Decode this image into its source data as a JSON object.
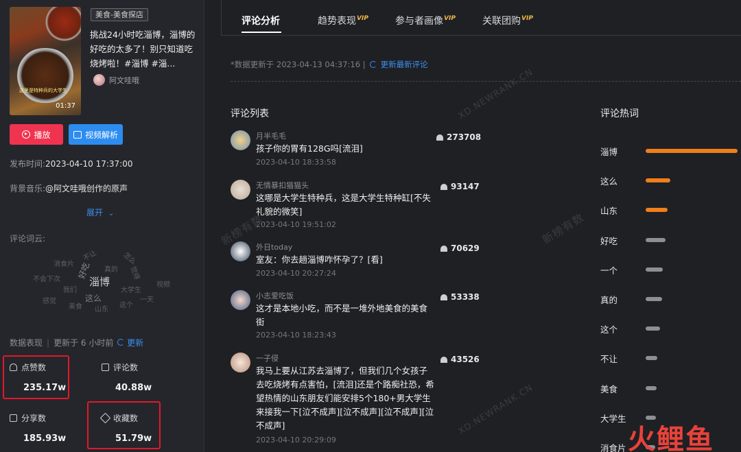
{
  "video": {
    "category": "美食-美食探店",
    "title": "挑战24小时吃淄博，淄博的好吃的太多了！别只知道吃烧烤啦！#淄博 #淄...",
    "author": "阿文哇哦",
    "duration": "01:37",
    "thumb_caption": "这里是特种兵的大学生"
  },
  "actions": {
    "play": "播放",
    "analyze": "视频解析"
  },
  "meta": {
    "publish_label": "发布时间:",
    "publish_time": "2023-04-10 17:37:00",
    "music_label": "背景音乐:",
    "music": "@阿文哇哦创作的原声",
    "expand": "展开"
  },
  "wordcloud": {
    "label": "评论词云:",
    "words": [
      "不让",
      "怎么",
      "消食片",
      "好吃",
      "真的",
      "不会下次",
      "淄博",
      "觉得",
      "大学生",
      "视频",
      "我们",
      "这么",
      "一天",
      "感觉",
      "美食",
      "这个",
      "山东"
    ]
  },
  "stats": {
    "header": "数据表现",
    "updated": "更新于 6 小时前",
    "refresh": "更新",
    "likes_label": "点赞数",
    "likes": "235.17w",
    "comments_label": "评论数",
    "comments": "40.88w",
    "shares_label": "分享数",
    "shares": "185.93w",
    "favorites_label": "收藏数",
    "favorites": "51.79w"
  },
  "tabs": [
    {
      "label": "评论分析",
      "vip": ""
    },
    {
      "label": "趋势表现",
      "vip": "VIP"
    },
    {
      "label": "参与者画像",
      "vip": "VIP"
    },
    {
      "label": "关联团购",
      "vip": "VIP"
    }
  ],
  "update": {
    "text": "*数据更新于 2023-04-13 04:37:16 |",
    "link": "更新最新评论"
  },
  "comment_list": {
    "title": "评论列表",
    "items": [
      {
        "user": "月半毛毛",
        "text": "孩子你的胃有128G吗[流泪]",
        "time": "2023-04-10 18:33:58",
        "likes": "273708"
      },
      {
        "user": "无情暴扣猫猫头",
        "text": "这哪是大学生特种兵，这是大学生特种缸[不失礼貌的微笑]",
        "time": "2023-04-10 19:51:02",
        "likes": "93147"
      },
      {
        "user": "外日today",
        "text": "室友：你去趟淄博咋怀孕了？[看]",
        "time": "2023-04-10 20:27:24",
        "likes": "70629"
      },
      {
        "user": "小志爱吃饭",
        "text": "这才是本地小吃，而不是一堆外地美食的美食街",
        "time": "2023-04-10 18:23:43",
        "likes": "53338"
      },
      {
        "user": "一子侵",
        "text": "我马上要从江苏去淄博了，但我们几个女孩子去吃烧烤有点害怕，[流泪]还是个路痴社恐，希望热情的山东朋友们能安排5个180+男大学生来接我一下[泣不成声][泣不成声][泣不成声][泣不成声]",
        "time": "2023-04-10 20:29:09",
        "likes": "43526"
      }
    ]
  },
  "hot_words": {
    "title": "评论热词",
    "items": [
      {
        "word": "淄博",
        "value": 1.0,
        "color": "#f07f1a"
      },
      {
        "word": "这么",
        "value": 0.27,
        "color": "#f07f1a"
      },
      {
        "word": "山东",
        "value": 0.24,
        "color": "#f07f1a"
      },
      {
        "word": "好吃",
        "value": 0.22,
        "color": "#8e8f93"
      },
      {
        "word": "一个",
        "value": 0.19,
        "color": "#8e8f93"
      },
      {
        "word": "真的",
        "value": 0.18,
        "color": "#8e8f93"
      },
      {
        "word": "这个",
        "value": 0.16,
        "color": "#8e8f93"
      },
      {
        "word": "不让",
        "value": 0.13,
        "color": "#8e8f93"
      },
      {
        "word": "美食",
        "value": 0.12,
        "color": "#8e8f93"
      },
      {
        "word": "大学生",
        "value": 0.11,
        "color": "#8e8f93"
      },
      {
        "word": "消食片",
        "value": 0.1,
        "color": "#8e8f93"
      }
    ]
  },
  "watermark": "XD.NEWRANK.CN",
  "watermark_cn": "新榜有数",
  "brand_logo": "火鲤鱼"
}
